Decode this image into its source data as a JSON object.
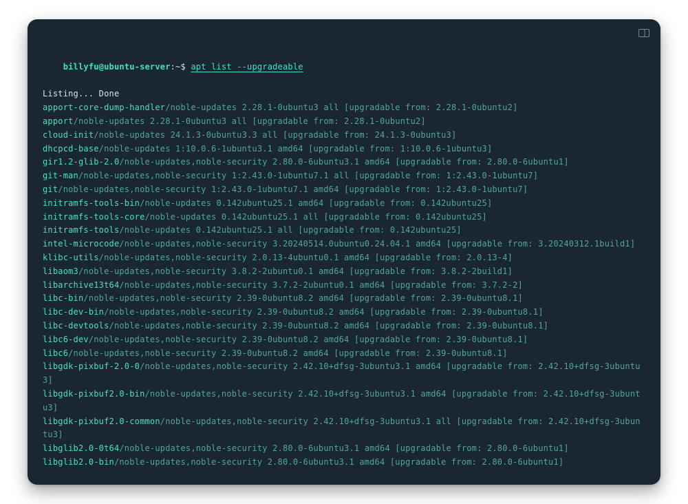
{
  "prompt": {
    "user_host": "billyfu@ubuntu-server",
    "sep": ":~",
    "dollar": "$",
    "command": "apt list --upgradeable"
  },
  "status_line": "Listing... Done",
  "packages": [
    {
      "name": "apport-core-dump-handler",
      "rest": "/noble-updates 2.28.1-0ubuntu3 all [upgradable from: 2.28.1-0ubuntu2]"
    },
    {
      "name": "apport",
      "rest": "/noble-updates 2.28.1-0ubuntu3 all [upgradable from: 2.28.1-0ubuntu2]"
    },
    {
      "name": "cloud-init",
      "rest": "/noble-updates 24.1.3-0ubuntu3.3 all [upgradable from: 24.1.3-0ubuntu3]"
    },
    {
      "name": "dhcpcd-base",
      "rest": "/noble-updates 1:10.0.6-1ubuntu3.1 amd64 [upgradable from: 1:10.0.6-1ubuntu3]"
    },
    {
      "name": "gir1.2-glib-2.0",
      "rest": "/noble-updates,noble-security 2.80.0-6ubuntu3.1 amd64 [upgradable from: 2.80.0-6ubuntu1]"
    },
    {
      "name": "git-man",
      "rest": "/noble-updates,noble-security 1:2.43.0-1ubuntu7.1 all [upgradable from: 1:2.43.0-1ubuntu7]"
    },
    {
      "name": "git",
      "rest": "/noble-updates,noble-security 1:2.43.0-1ubuntu7.1 amd64 [upgradable from: 1:2.43.0-1ubuntu7]"
    },
    {
      "name": "initramfs-tools-bin",
      "rest": "/noble-updates 0.142ubuntu25.1 amd64 [upgradable from: 0.142ubuntu25]"
    },
    {
      "name": "initramfs-tools-core",
      "rest": "/noble-updates 0.142ubuntu25.1 all [upgradable from: 0.142ubuntu25]"
    },
    {
      "name": "initramfs-tools",
      "rest": "/noble-updates 0.142ubuntu25.1 all [upgradable from: 0.142ubuntu25]"
    },
    {
      "name": "intel-microcode",
      "rest": "/noble-updates,noble-security 3.20240514.0ubuntu0.24.04.1 amd64 [upgradable from: 3.20240312.1build1]"
    },
    {
      "name": "klibc-utils",
      "rest": "/noble-updates,noble-security 2.0.13-4ubuntu0.1 amd64 [upgradable from: 2.0.13-4]"
    },
    {
      "name": "libaom3",
      "rest": "/noble-updates,noble-security 3.8.2-2ubuntu0.1 amd64 [upgradable from: 3.8.2-2build1]"
    },
    {
      "name": "libarchive13t64",
      "rest": "/noble-updates,noble-security 3.7.2-2ubuntu0.1 amd64 [upgradable from: 3.7.2-2]"
    },
    {
      "name": "libc-bin",
      "rest": "/noble-updates,noble-security 2.39-0ubuntu8.2 amd64 [upgradable from: 2.39-0ubuntu8.1]"
    },
    {
      "name": "libc-dev-bin",
      "rest": "/noble-updates,noble-security 2.39-0ubuntu8.2 amd64 [upgradable from: 2.39-0ubuntu8.1]"
    },
    {
      "name": "libc-devtools",
      "rest": "/noble-updates,noble-security 2.39-0ubuntu8.2 amd64 [upgradable from: 2.39-0ubuntu8.1]"
    },
    {
      "name": "libc6-dev",
      "rest": "/noble-updates,noble-security 2.39-0ubuntu8.2 amd64 [upgradable from: 2.39-0ubuntu8.1]"
    },
    {
      "name": "libc6",
      "rest": "/noble-updates,noble-security 2.39-0ubuntu8.2 amd64 [upgradable from: 2.39-0ubuntu8.1]"
    },
    {
      "name": "libgdk-pixbuf-2.0-0",
      "rest": "/noble-updates,noble-security 2.42.10+dfsg-3ubuntu3.1 amd64 [upgradable from: 2.42.10+dfsg-3ubuntu3]"
    },
    {
      "name": "libgdk-pixbuf2.0-bin",
      "rest": "/noble-updates,noble-security 2.42.10+dfsg-3ubuntu3.1 amd64 [upgradable from: 2.42.10+dfsg-3ubuntu3]"
    },
    {
      "name": "libgdk-pixbuf2.0-common",
      "rest": "/noble-updates,noble-security 2.42.10+dfsg-3ubuntu3.1 all [upgradable from: 2.42.10+dfsg-3ubuntu3]"
    },
    {
      "name": "libglib2.0-0t64",
      "rest": "/noble-updates,noble-security 2.80.0-6ubuntu3.1 amd64 [upgradable from: 2.80.0-6ubuntu1]"
    },
    {
      "name": "libglib2.0-bin",
      "rest": "/noble-updates,noble-security 2.80.0-6ubuntu3.1 amd64 [upgradable from: 2.80.0-6ubuntu1]"
    }
  ]
}
